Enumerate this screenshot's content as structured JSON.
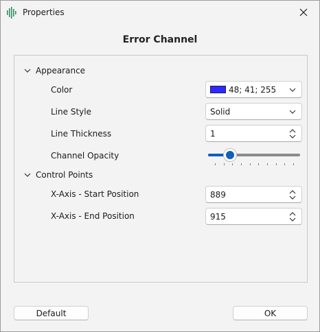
{
  "window": {
    "title": "Properties",
    "icon": "waveform-icon",
    "close_icon": "close-icon"
  },
  "dialog": {
    "heading": "Error Channel"
  },
  "appearance": {
    "label": "Appearance",
    "color": {
      "label": "Color",
      "value": "48; 41; 255",
      "swatch_hex": "#3029ff"
    },
    "line_style": {
      "label": "Line Style",
      "value": "Solid"
    },
    "line_thickness": {
      "label": "Line Thickness",
      "value": "1"
    },
    "channel_opacity": {
      "label": "Channel Opacity",
      "value_fraction": 0.24,
      "tick_count": 10
    }
  },
  "control_points": {
    "label": "Control Points",
    "x_start": {
      "label": "X-Axis - Start Position",
      "value": "889"
    },
    "x_end": {
      "label": "X-Axis - End Position",
      "value": "915"
    }
  },
  "buttons": {
    "default_label": "Default",
    "ok_label": "OK"
  },
  "colors": {
    "accent": "#0f5fbf"
  }
}
